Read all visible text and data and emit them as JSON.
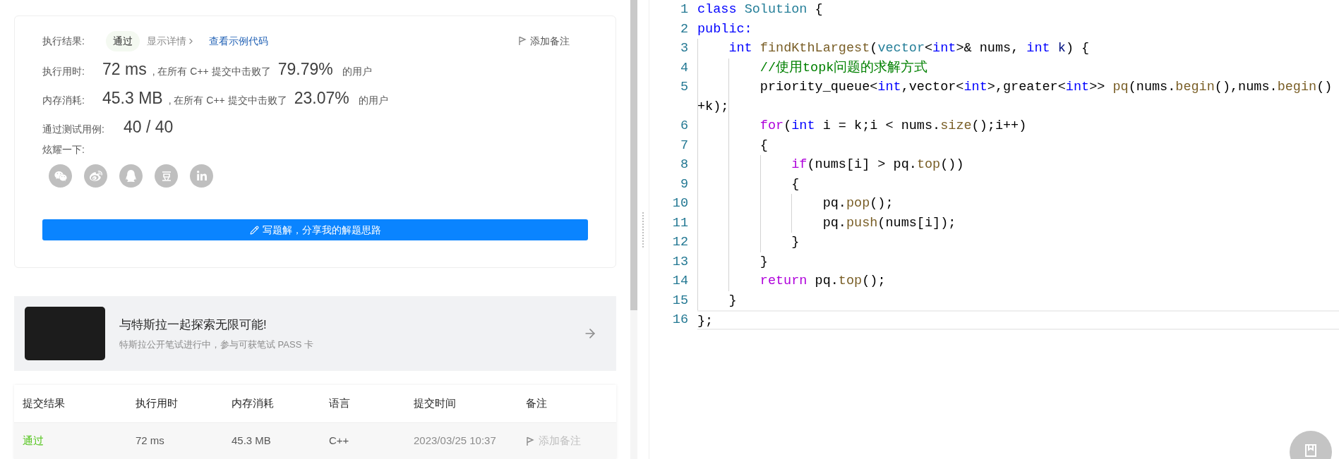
{
  "result": {
    "label": "执行结果:",
    "status": "通过",
    "details_link": "显示详情",
    "example_link": "查看示例代码",
    "note_button": "添加备注"
  },
  "stats": [
    {
      "label": "执行用时:",
      "value": "72 ms",
      "middle": ", 在所有 C++ 提交中击败了",
      "percent": "79.79%",
      "suffix": "的用户"
    },
    {
      "label": "内存消耗:",
      "value": "45.3 MB",
      "middle": ", 在所有 C++ 提交中击败了",
      "percent": "23.07%",
      "suffix": "的用户"
    }
  ],
  "tests": {
    "label": "通过测试用例:",
    "value": "40 / 40"
  },
  "share": {
    "label": "炫耀一下:",
    "icons": [
      {
        "kind": "wechat"
      },
      {
        "kind": "weibo"
      },
      {
        "kind": "qq"
      },
      {
        "kind": "douban"
      },
      {
        "kind": "linkedin"
      }
    ]
  },
  "write_button": "写题解，分享我的解题思路",
  "banner": {
    "title": "与特斯拉一起探索无限可能!",
    "subtitle": "特斯拉公开笔试进行中，参与可获笔试 PASS 卡"
  },
  "table": {
    "columns": [
      "提交结果",
      "执行用时",
      "内存消耗",
      "语言",
      "提交时间",
      "备注"
    ],
    "rows": [
      {
        "status": "通过",
        "time": "72 ms",
        "memory": "45.3 MB",
        "language": "C++",
        "submitted": "2023/03/25 10:37",
        "note": "添加备注"
      }
    ]
  },
  "code": {
    "lines": [
      {
        "kind": "line",
        "number": "1",
        "current": false,
        "tokens": [
          {
            "kind": "keyword",
            "text": "class "
          },
          {
            "kind": "type",
            "text": "Solution"
          },
          {
            "kind": "plain",
            "text": " {"
          }
        ]
      },
      {
        "kind": "line",
        "number": "2",
        "current": false,
        "tokens": [
          {
            "kind": "keyword",
            "text": "public:"
          }
        ]
      },
      {
        "kind": "line",
        "number": "3",
        "current": false,
        "tokens": [
          {
            "kind": "keyword",
            "text": "    int "
          },
          {
            "kind": "function",
            "text": "findKthLargest"
          },
          {
            "kind": "plain",
            "text": "("
          },
          {
            "kind": "type",
            "text": "vector"
          },
          {
            "kind": "plain",
            "text": "<"
          },
          {
            "kind": "keyword",
            "text": "int"
          },
          {
            "kind": "plain",
            "text": ">& nums, "
          },
          {
            "kind": "keyword",
            "text": "int "
          },
          {
            "kind": "param",
            "text": "k"
          },
          {
            "kind": "plain",
            "text": ") {"
          }
        ]
      },
      {
        "kind": "line",
        "number": "4",
        "current": false,
        "tokens": [
          {
            "kind": "comment",
            "text": "        //使用topk问题的求解方式"
          }
        ]
      },
      {
        "kind": "line",
        "number": "5",
        "current": false,
        "tokens": [
          {
            "kind": "plain",
            "text": "        priority_queue<"
          },
          {
            "kind": "keyword",
            "text": "int"
          },
          {
            "kind": "plain",
            "text": ",vector<"
          },
          {
            "kind": "keyword",
            "text": "int"
          },
          {
            "kind": "plain",
            "text": ">,greater<"
          },
          {
            "kind": "keyword",
            "text": "int"
          },
          {
            "kind": "plain",
            "text": ">> "
          },
          {
            "kind": "function",
            "text": "pq"
          },
          {
            "kind": "plain",
            "text": "(nums."
          },
          {
            "kind": "function",
            "text": "begin"
          },
          {
            "kind": "plain",
            "text": "(),nums."
          },
          {
            "kind": "function",
            "text": "begin"
          },
          {
            "kind": "plain",
            "text": "()"
          }
        ]
      },
      {
        "kind": "wrap",
        "tokens": [
          {
            "kind": "plain",
            "text": "+k);"
          }
        ]
      },
      {
        "kind": "line",
        "number": "6",
        "current": false,
        "tokens": [
          {
            "kind": "control",
            "text": "        for"
          },
          {
            "kind": "plain",
            "text": "("
          },
          {
            "kind": "keyword",
            "text": "int"
          },
          {
            "kind": "plain",
            "text": " i = k;i < nums."
          },
          {
            "kind": "function",
            "text": "size"
          },
          {
            "kind": "plain",
            "text": "();i++)"
          }
        ]
      },
      {
        "kind": "line",
        "number": "7",
        "current": false,
        "tokens": [
          {
            "kind": "plain",
            "text": "        {"
          }
        ]
      },
      {
        "kind": "line",
        "number": "8",
        "current": false,
        "tokens": [
          {
            "kind": "control",
            "text": "            if"
          },
          {
            "kind": "plain",
            "text": "(nums[i] > pq."
          },
          {
            "kind": "function",
            "text": "top"
          },
          {
            "kind": "plain",
            "text": "())"
          }
        ]
      },
      {
        "kind": "line",
        "number": "9",
        "current": false,
        "tokens": [
          {
            "kind": "plain",
            "text": "            {"
          }
        ]
      },
      {
        "kind": "line",
        "number": "10",
        "current": false,
        "tokens": [
          {
            "kind": "plain",
            "text": "                pq."
          },
          {
            "kind": "function",
            "text": "pop"
          },
          {
            "kind": "plain",
            "text": "();"
          }
        ]
      },
      {
        "kind": "line",
        "number": "11",
        "current": false,
        "tokens": [
          {
            "kind": "plain",
            "text": "                pq."
          },
          {
            "kind": "function",
            "text": "push"
          },
          {
            "kind": "plain",
            "text": "(nums[i]);"
          }
        ]
      },
      {
        "kind": "line",
        "number": "12",
        "current": false,
        "tokens": [
          {
            "kind": "plain",
            "text": "            }"
          }
        ]
      },
      {
        "kind": "line",
        "number": "13",
        "current": false,
        "tokens": [
          {
            "kind": "plain",
            "text": "        }"
          }
        ]
      },
      {
        "kind": "line",
        "number": "14",
        "current": false,
        "tokens": [
          {
            "kind": "control",
            "text": "        return"
          },
          {
            "kind": "plain",
            "text": " pq."
          },
          {
            "kind": "function",
            "text": "top"
          },
          {
            "kind": "plain",
            "text": "();"
          }
        ]
      },
      {
        "kind": "line",
        "number": "15",
        "current": false,
        "tokens": [
          {
            "kind": "plain",
            "text": "    }"
          }
        ]
      },
      {
        "kind": "line",
        "number": "16",
        "current": true,
        "tokens": [
          {
            "kind": "plain",
            "text": "};"
          }
        ]
      }
    ]
  }
}
